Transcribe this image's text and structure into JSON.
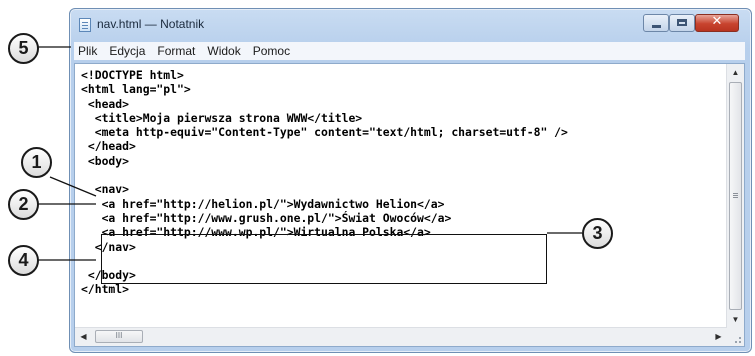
{
  "window": {
    "title": "nav.html — Notatnik",
    "close_glyph": "✕"
  },
  "menu": {
    "items": [
      {
        "label": "Plik"
      },
      {
        "label": "Edycja"
      },
      {
        "label": "Format"
      },
      {
        "label": "Widok"
      },
      {
        "label": "Pomoc"
      }
    ]
  },
  "editor": {
    "lines": [
      "<!DOCTYPE html>",
      "<html lang=\"pl\">",
      " <head>",
      "  <title>Moja pierwsza strona WWW</title>",
      "  <meta http-equiv=\"Content-Type\" content=\"text/html; charset=utf-8\" />",
      " </head>",
      " <body>",
      "",
      "  <nav>",
      "   <a href=\"http://helion.pl/\">Wydawnictwo Helion</a>",
      "   <a href=\"http://www.grush.one.pl/\">Świat Owoców</a>",
      "   <a href=\"http://www.wp.pl/\">Wirtualna Polska</a>",
      "  </nav>",
      "",
      " </body>",
      "</html>"
    ]
  },
  "scrollbars": {
    "up_glyph": "▲",
    "down_glyph": "▼",
    "left_glyph": "◀",
    "right_glyph": "▶",
    "thumb_grip": "III"
  },
  "callouts": {
    "c1": "1",
    "c2": "2",
    "c3": "3",
    "c4": "4",
    "c5": "5"
  },
  "colors": {
    "titlebar": "#c9dcf2",
    "close_button": "#c8432e",
    "menubar": "#f3f6fb",
    "text": "#000000"
  }
}
